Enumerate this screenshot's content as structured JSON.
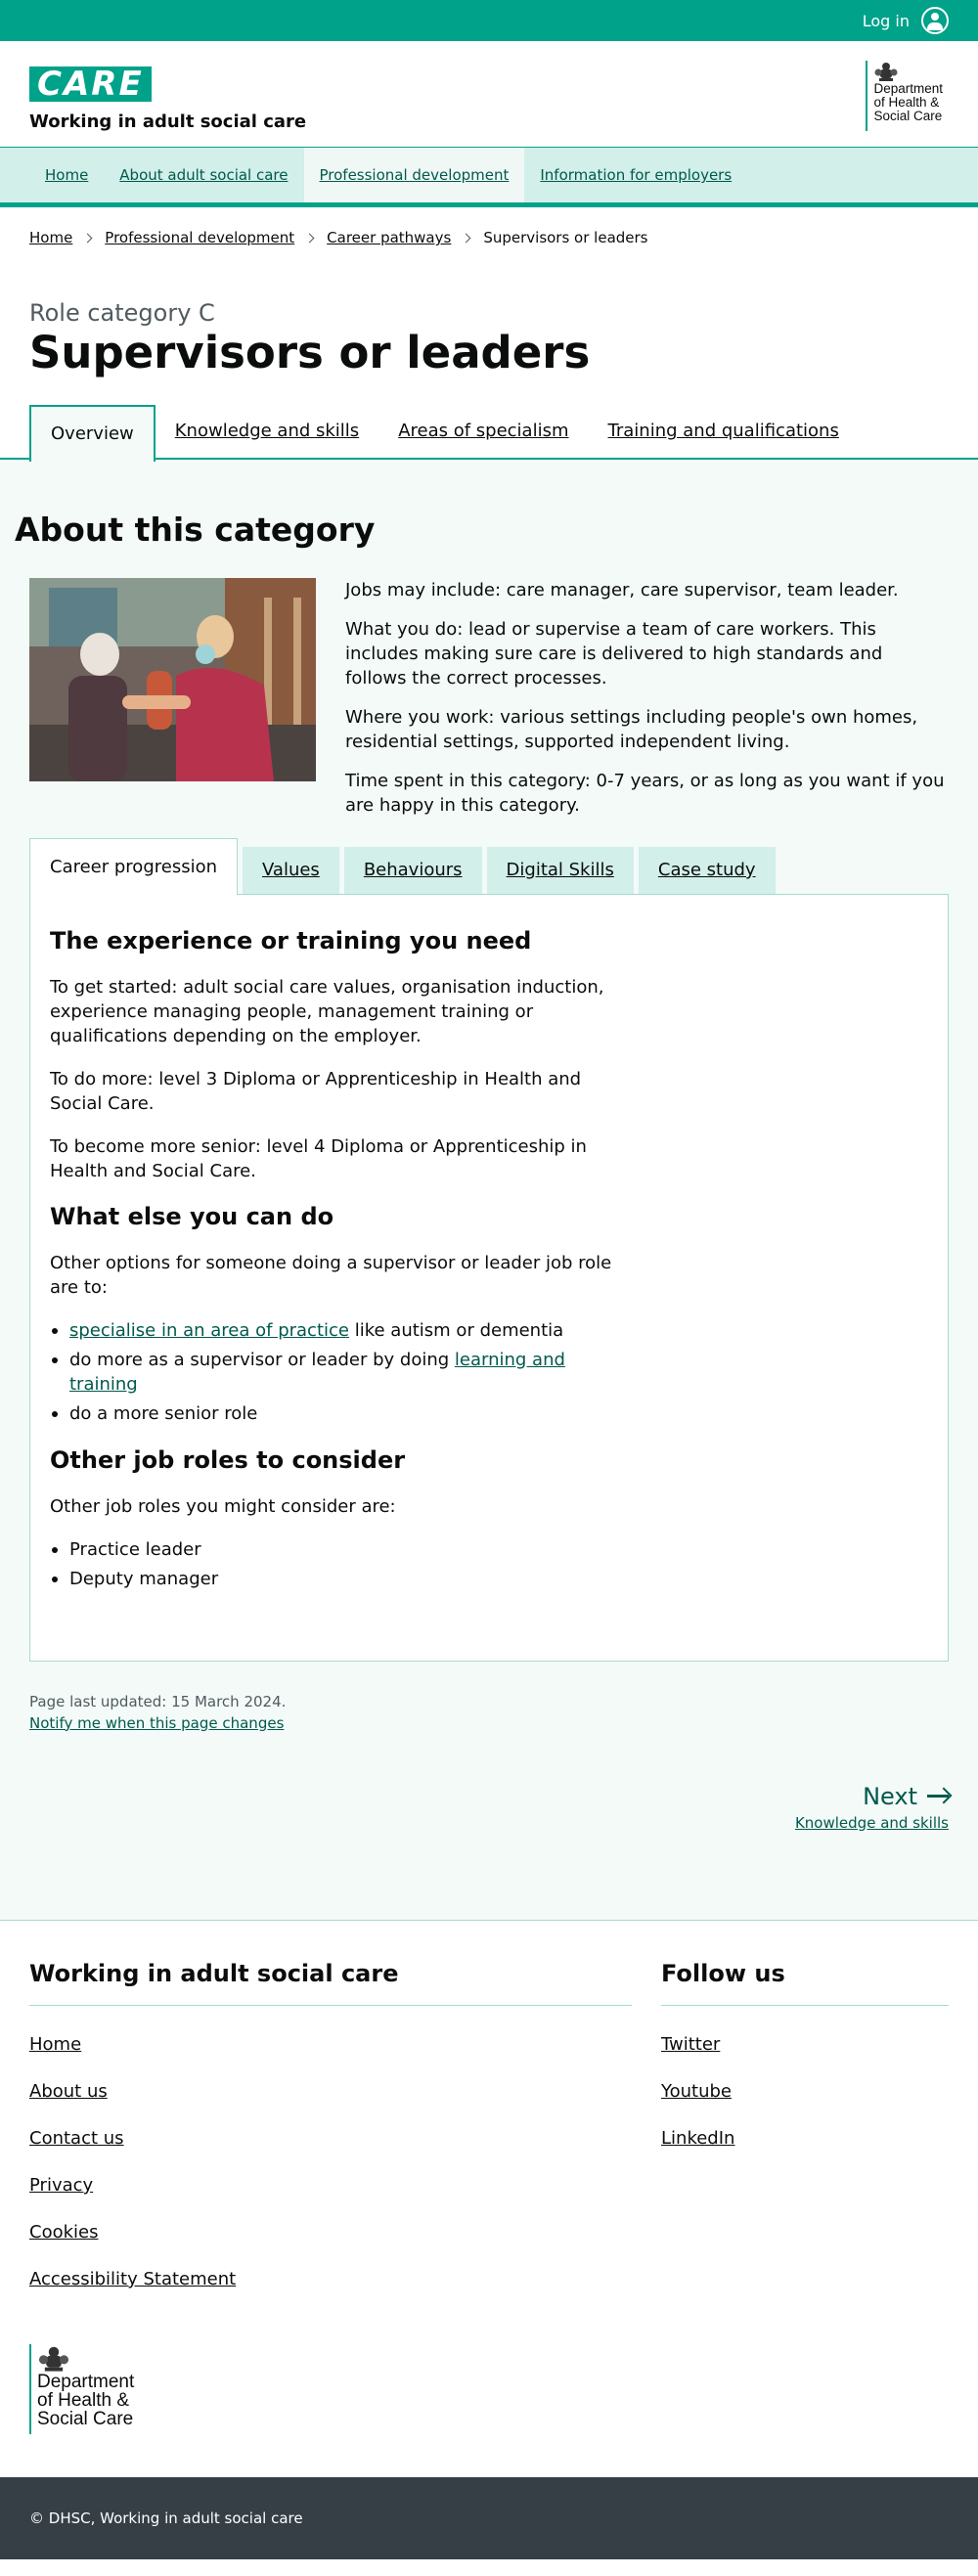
{
  "topbar": {
    "login_label": "Log in"
  },
  "header": {
    "logo_text": "CARE",
    "service_name": "Working in adult social care",
    "dept_line1": "Department",
    "dept_line2": "of Health &",
    "dept_line3": "Social Care"
  },
  "nav": {
    "items": [
      {
        "label": "Home"
      },
      {
        "label": "About adult social care"
      },
      {
        "label": "Professional development"
      },
      {
        "label": "Information for employers"
      }
    ]
  },
  "breadcrumb": {
    "items": [
      "Home",
      "Professional development",
      "Career pathways"
    ],
    "current": "Supervisors or leaders"
  },
  "page": {
    "caption": "Role category C",
    "title": "Supervisors or leaders",
    "tabs": [
      "Overview",
      "Knowledge and skills",
      "Areas of specialism",
      "Training and qualifications"
    ]
  },
  "about": {
    "title": "About this category",
    "paragraphs": [
      "Jobs may include: care manager, care supervisor, team leader.",
      "What you do: lead or supervise a team of care workers. This includes making sure care is delivered to high standards and follows the correct processes.",
      "Where you work: various settings including people's own homes, residential settings, supported independent living.",
      "Time spent in this category: 0-7 years, or as long as you want if you are happy in this category."
    ]
  },
  "inner_tabs": [
    "Career progression",
    "Values",
    "Behaviours",
    "Digital Skills",
    "Case study"
  ],
  "career": {
    "h1": "The experience or training you need",
    "p1": "To get started: adult social care values, organisation induction, experience managing people, management training or qualifications depending on the employer.",
    "p2": "To do more: level 3 Diploma or Apprenticeship in Health and Social Care.",
    "p3": "To become more senior: level 4 Diploma or Apprenticeship in Health and Social Care.",
    "h2": "What else you can do",
    "p4": "Other options for someone doing a supervisor or leader job role are to:",
    "li1_link": "specialise in an area of practice",
    "li1_rest": " like autism or dementia",
    "li2_text": "do more as a supervisor or leader by doing ",
    "li2_link": "learning and training",
    "li3": "do a more senior role",
    "h3": "Other job roles to consider",
    "p5": "Other job roles you might consider are:",
    "roles": [
      "Practice leader",
      "Deputy manager"
    ]
  },
  "updated": {
    "text": "Page last updated: 15 March 2024.",
    "notify": "Notify me when this page changes"
  },
  "next": {
    "label": "Next",
    "target": "Knowledge and skills"
  },
  "footer": {
    "left_title": "Working in adult social care",
    "left_links": [
      "Home",
      "About us",
      "Contact us",
      "Privacy",
      "Cookies",
      "Accessibility Statement"
    ],
    "right_title": "Follow us",
    "right_links": [
      "Twitter",
      "Youtube",
      "LinkedIn"
    ],
    "copyright": "© DHSC, Working in adult social care"
  },
  "colors": {
    "brand": "#00a28a",
    "link": "#00594c",
    "nav_bg": "#d2efe9",
    "footer_bar": "#363f46"
  }
}
